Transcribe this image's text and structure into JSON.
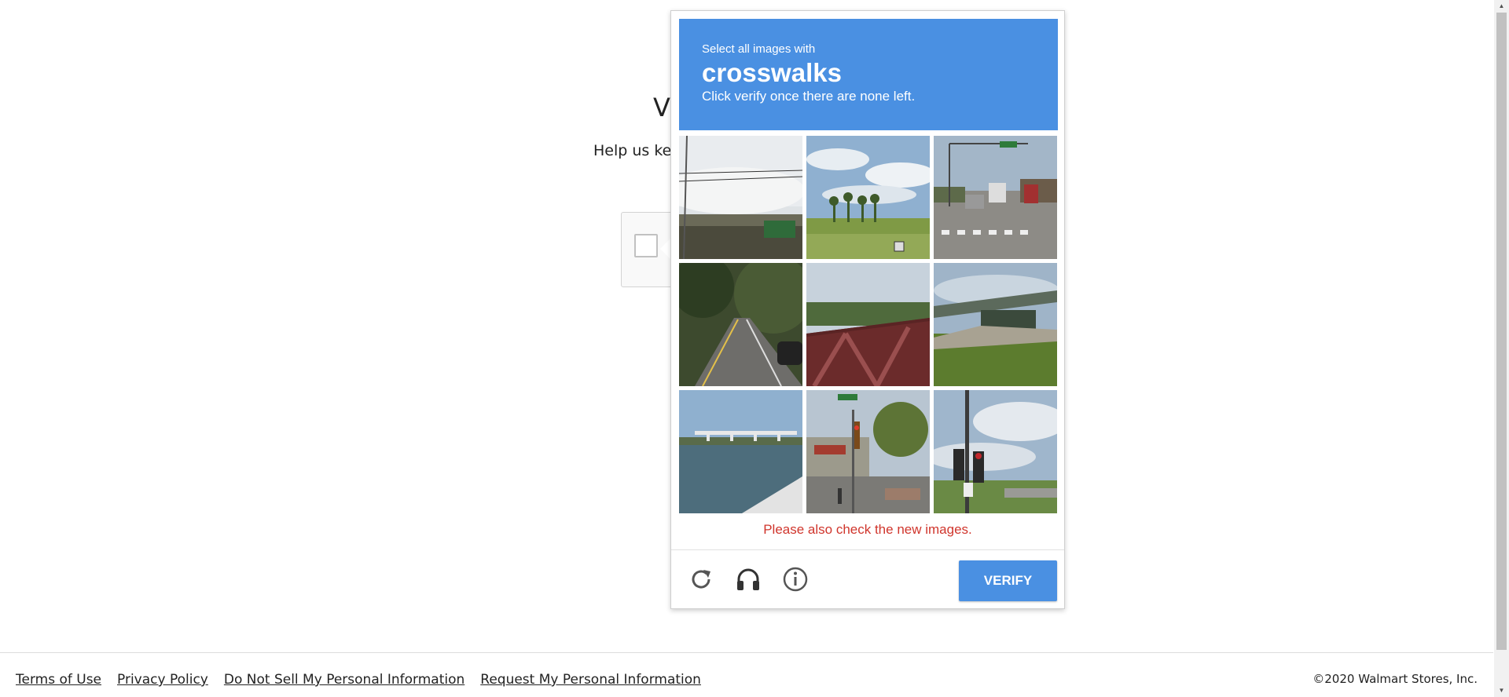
{
  "background_page": {
    "title": "V",
    "subtitle": "Help us kee"
  },
  "challenge": {
    "header": {
      "instruction_small": "Select all images with",
      "target": "crosswalks",
      "instruction": "Click verify once there are none left."
    },
    "tiles": [
      {
        "label": "sky-power-lines-sign",
        "selected": false
      },
      {
        "label": "palm-trees-field",
        "selected": false
      },
      {
        "label": "street-traffic-crosswalk",
        "selected": false
      },
      {
        "label": "road-trees-car",
        "selected": false
      },
      {
        "label": "bridge-railing",
        "selected": false
      },
      {
        "label": "overpass-grass",
        "selected": false
      },
      {
        "label": "river-bridge",
        "selected": false
      },
      {
        "label": "intersection-traffic-light",
        "selected": false
      },
      {
        "label": "traffic-signal-sky",
        "selected": false
      }
    ],
    "error_message": "Please also check the new images.",
    "controls": {
      "reload_icon": "reload-icon",
      "audio_icon": "headphones-icon",
      "info_icon": "info-icon"
    },
    "verify_label": "VERIFY",
    "colors": {
      "header_blue": "#4a90e2",
      "error_red": "#d0352c"
    }
  },
  "footer": {
    "links": [
      "Terms of Use",
      "Privacy Policy",
      "Do Not Sell My Personal Information",
      "Request My Personal Information"
    ],
    "copyright": "©2020 Walmart Stores, Inc."
  }
}
